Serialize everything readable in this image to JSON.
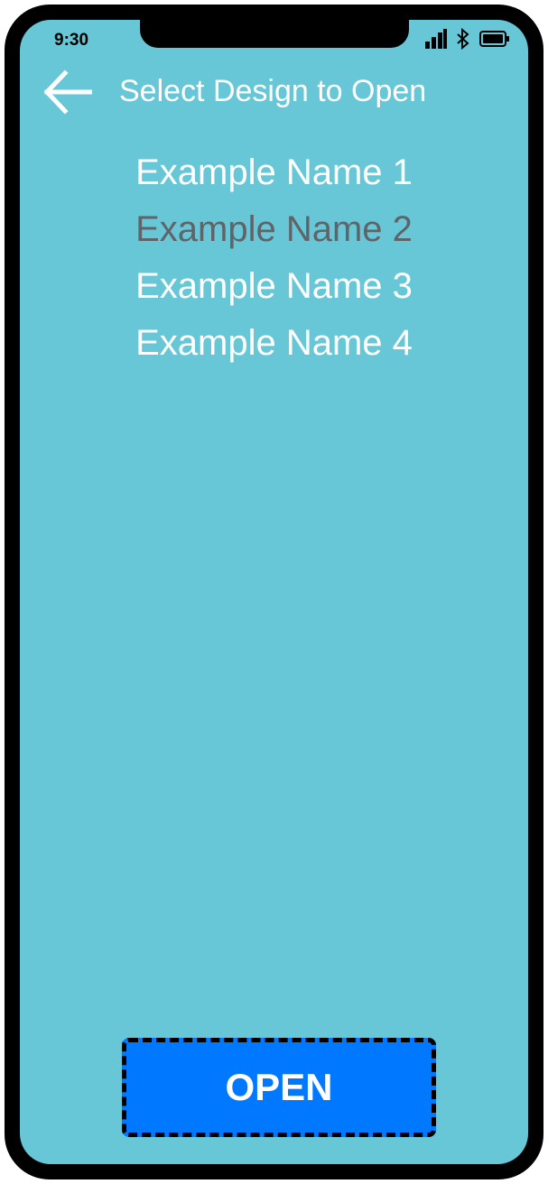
{
  "status_bar": {
    "time": "9:30",
    "icons": [
      "signal-icon",
      "bluetooth-icon",
      "battery-icon"
    ]
  },
  "header": {
    "back_icon": "back-arrow-icon",
    "title": "Select Design to Open"
  },
  "design_list": {
    "items": [
      {
        "label": "Example Name 1",
        "selected": false
      },
      {
        "label": "Example Name 2",
        "selected": true
      },
      {
        "label": "Example Name 3",
        "selected": false
      },
      {
        "label": "Example Name 4",
        "selected": false
      }
    ]
  },
  "actions": {
    "open_label": "OPEN"
  },
  "colors": {
    "background": "#67c7d6",
    "text": "#ffffff",
    "selected_text": "#5f6469",
    "button": "#0078ff",
    "frame": "#000000"
  }
}
